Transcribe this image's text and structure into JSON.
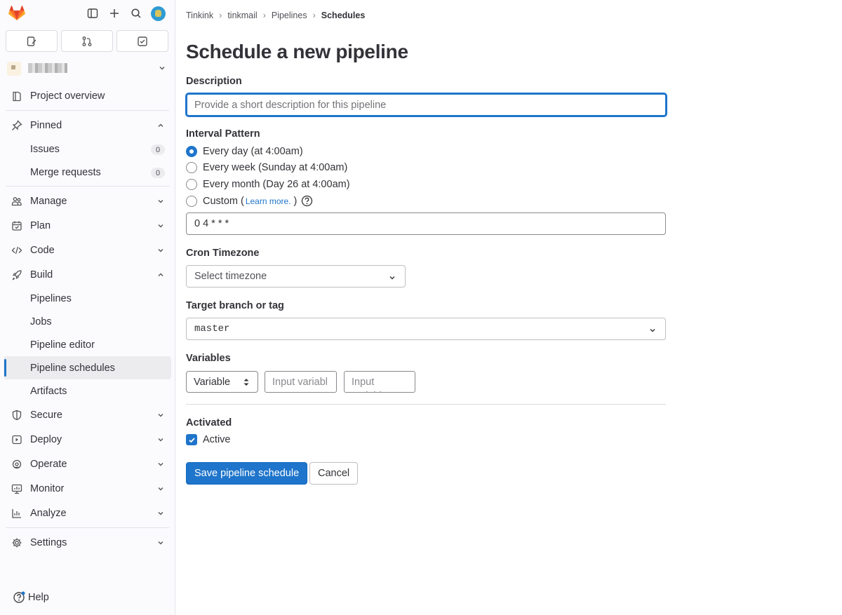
{
  "sidebar": {
    "tabs": [
      {
        "name": "issues-tab",
        "icon": "issues-icon"
      },
      {
        "name": "merge-requests-tab",
        "icon": "merge-request-icon"
      },
      {
        "name": "todos-tab",
        "icon": "todo-icon"
      }
    ],
    "project_overview": "Project overview",
    "pinned": "Pinned",
    "pinned_items": [
      {
        "label": "Issues",
        "count": "0"
      },
      {
        "label": "Merge requests",
        "count": "0"
      }
    ],
    "manage": "Manage",
    "plan": "Plan",
    "code": "Code",
    "build": "Build",
    "build_items": [
      "Pipelines",
      "Jobs",
      "Pipeline editor",
      "Pipeline schedules",
      "Artifacts"
    ],
    "secure": "Secure",
    "deploy": "Deploy",
    "operate": "Operate",
    "monitor": "Monitor",
    "analyze": "Analyze",
    "settings": "Settings",
    "help": "Help"
  },
  "breadcrumbs": [
    "Tinkink",
    "tinkmail",
    "Pipelines",
    "Schedules"
  ],
  "page": {
    "title": "Schedule a new pipeline",
    "description_label": "Description",
    "description_placeholder": "Provide a short description for this pipeline",
    "interval_label": "Interval Pattern",
    "interval_options": [
      {
        "label": "Every day (at 4:00am)",
        "selected": true
      },
      {
        "label": "Every week (Sunday at 4:00am)",
        "selected": false
      },
      {
        "label": "Every month (Day 26 at 4:00am)",
        "selected": false
      }
    ],
    "custom_label_prefix": "Custom (",
    "custom_learn_more": "Learn more.",
    "custom_label_suffix": ")",
    "cron_value": "0 4 * * *",
    "timezone_label": "Cron Timezone",
    "timezone_placeholder": "Select timezone",
    "branch_label": "Target branch or tag",
    "branch_value": "master",
    "variables_label": "Variables",
    "variable_type": "Variable",
    "variable_key_placeholder": "Input variabl",
    "variable_value_placeholder": "Input variable",
    "activated_label": "Activated",
    "active_label": "Active",
    "active_checked": true,
    "save_button": "Save pipeline schedule",
    "cancel_button": "Cancel"
  },
  "colors": {
    "accent": "#1f75cb",
    "logo": "#e24329"
  }
}
